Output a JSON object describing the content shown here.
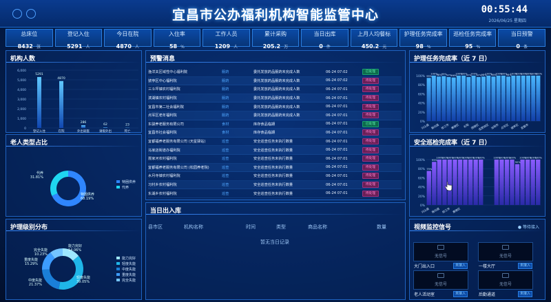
{
  "header": {
    "title": "宜昌市公办福利机构智能监管中心",
    "time": "00:55:44",
    "date": "2026/06/25 星期四"
  },
  "stats": [
    {
      "label": "总床位",
      "value": "8432",
      "unit": "张"
    },
    {
      "label": "登记入住",
      "value": "5291",
      "unit": "人"
    },
    {
      "label": "今日在院",
      "value": "4870",
      "unit": "人"
    },
    {
      "label": "入住率",
      "value": "58",
      "unit": "%"
    },
    {
      "label": "工作人员",
      "value": "1209",
      "unit": "人"
    },
    {
      "label": "累计采购",
      "value": "205.2",
      "unit": "万"
    },
    {
      "label": "当日出库",
      "value": "0",
      "unit": "件"
    },
    {
      "label": "上月人均餐标",
      "value": "450.2",
      "unit": "元"
    },
    {
      "label": "护理任务完成率",
      "value": "98",
      "unit": "%"
    },
    {
      "label": "巡检任务完成率",
      "value": "95",
      "unit": "%"
    },
    {
      "label": "当日预警",
      "value": "0",
      "unit": "条"
    }
  ],
  "panels": {
    "institution": "机构人数",
    "elder_type": "老人类型占比",
    "care_level": "护理级别分布",
    "warning": "预警消息",
    "outbound": "当日出入库",
    "care_rate": "护理任务完成率（近 7 日）",
    "patrol_rate": "安全巡检完成率（近 7 日）",
    "video": "视频监控信号",
    "video_status": "● 等待接入"
  },
  "chart_data": [
    {
      "type": "bar",
      "title": "机构人数",
      "categories": [
        "登记入住",
        "在院",
        "外出就医",
        "请假外出",
        "死亡"
      ],
      "values": [
        5291,
        4870,
        286,
        62,
        23
      ],
      "ylim": [
        0,
        6000
      ],
      "yticks": [
        0,
        1000,
        2000,
        3000,
        4000,
        5000,
        6000
      ]
    },
    {
      "type": "pie",
      "title": "老人类型占比",
      "slices": [
        {
          "name": "特困供养",
          "value": 68.19
        },
        {
          "name": "代养",
          "value": 31.81
        }
      ],
      "labels": [
        "代养\n31.81%",
        "特困供养\n68.19%"
      ],
      "colors": [
        "#2f86ff",
        "#1fd6f0"
      ]
    },
    {
      "type": "pie",
      "title": "护理级别分布",
      "slices": [
        {
          "name": "能力完好",
          "value": 14.06
        },
        {
          "name": "轻度失能",
          "value": 39.05
        },
        {
          "name": "中度失能",
          "value": 21.37
        },
        {
          "name": "重度失能",
          "value": 15.29
        },
        {
          "name": "完全失能",
          "value": 10.23
        }
      ],
      "colors": [
        "#9ee7ff",
        "#1fb6e8",
        "#1a7fd8",
        "#3d9cff",
        "#74c4ff"
      ]
    },
    {
      "type": "bar",
      "title": "护理任务完成率（近 7 日）",
      "ylim": [
        0,
        100
      ],
      "yticks": [
        "0%",
        "20%",
        "40%",
        "60%",
        "80%",
        "100%"
      ],
      "categories": [
        "兴山县",
        "",
        "秭归县",
        "",
        "枝江市",
        "",
        "夷陵区",
        "",
        "长阳",
        "",
        "西陵区",
        "",
        "伍家岗区",
        "",
        "当阳市",
        "",
        "点军区",
        "",
        "猇亭区",
        "",
        "宜都市",
        "",
        ""
      ],
      "values": [
        95,
        100,
        98,
        99,
        97,
        96,
        100,
        100,
        97,
        100,
        97,
        98,
        100,
        98,
        100,
        100,
        98,
        100,
        100,
        100,
        100,
        100,
        100
      ]
    },
    {
      "type": "bar",
      "title": "安全巡检完成率（近 7 日）",
      "ylim": [
        0,
        100
      ],
      "yticks": [
        "0%",
        "20%",
        "40%",
        "60%",
        "80%",
        "100%"
      ],
      "categories": [
        "兴山县",
        "",
        "秭归县",
        "",
        "枝江市",
        "",
        "夷陵区",
        "",
        "",
        "",
        "",
        "",
        "",
        "",
        "",
        "",
        "",
        "",
        "",
        "",
        "",
        ""
      ],
      "values": [
        75,
        95,
        100,
        100,
        100,
        100,
        100,
        100,
        100,
        100,
        100,
        0,
        0,
        100,
        100,
        100,
        100,
        90,
        100,
        100,
        100,
        100
      ]
    }
  ],
  "warnings": [
    {
      "org": "渔洋关区域性中心福利院",
      "type": "服药",
      "desc": "委托发放药品服药未完成人数",
      "time": "06-24 07:02",
      "status": "已处理"
    },
    {
      "org": "猇亭区中心福利院",
      "type": "服药",
      "desc": "委托发放药品服药未完成人数",
      "time": "06-24 07:02",
      "status": "待处理"
    },
    {
      "org": "三斗坪镇农村福利院",
      "type": "服药",
      "desc": "委托发放药品服药未完成人数",
      "time": "06-24 07:01",
      "status": "待处理"
    },
    {
      "org": "滨湖镇农村福利院",
      "type": "服药",
      "desc": "委托发放药品服药未完成人数",
      "time": "06-24 07:01",
      "status": "待处理"
    },
    {
      "org": "宜昌市第二社会福利院",
      "type": "服药",
      "desc": "委托发放药品服药未完成人数",
      "time": "06-24 07:01",
      "status": "待处理"
    },
    {
      "org": "点军区老年福利院",
      "type": "服药",
      "desc": "委托发放药品服药未完成人数",
      "time": "06-24 07:01",
      "status": "待处理"
    },
    {
      "org": "东骏养老服务有限公司",
      "type": "食材",
      "desc": "库存食品临期",
      "time": "06-24 07:01",
      "status": "已处理"
    },
    {
      "org": "宜昌市社会福利院",
      "type": "食材",
      "desc": "库存食品临期",
      "time": "06-24 07:01",
      "status": "待处理"
    },
    {
      "org": "宜都福养老服务有限公司 (天星驿站)",
      "type": "巡查",
      "desc": "安全巡查任务未执行数量",
      "time": "06-24 07:01",
      "status": "待处理"
    },
    {
      "org": "马家店街道办福利院",
      "type": "巡查",
      "desc": "安全巡查任务未执行数量",
      "time": "06-24 07:01",
      "status": "待处理"
    },
    {
      "org": "聂家河农村福利院",
      "type": "巡查",
      "desc": "安全巡查任务未执行数量",
      "time": "06-24 07:01",
      "status": "待处理"
    },
    {
      "org": "宜都福养老服务有限公司 (松园养老院)",
      "type": "巡查",
      "desc": "安全巡查任务未执行数量",
      "time": "06-24 07:01",
      "status": "待处理"
    },
    {
      "org": "水月寺镇农村福利院",
      "type": "巡查",
      "desc": "安全巡查任务未执行数量",
      "time": "06-24 07:01",
      "status": "待处理"
    },
    {
      "org": "习村乡农村福利院",
      "type": "巡查",
      "desc": "安全巡查任务未执行数量",
      "time": "06-24 07:01",
      "status": "待处理"
    },
    {
      "org": "东湖乡农村福利院",
      "type": "巡查",
      "desc": "安全巡查任务未执行数量",
      "time": "06-24 07:01",
      "status": "待处理"
    }
  ],
  "outbound_table": {
    "headers": [
      "县市区",
      "机构名称",
      "时间",
      "类型",
      "商品名称",
      "数量"
    ],
    "empty": "暂无当日记录"
  },
  "videos": [
    {
      "label": "大门出入口",
      "status": "无信号",
      "btn": "未接入"
    },
    {
      "label": "一楼大厅",
      "status": "无信号",
      "btn": "未接入"
    },
    {
      "label": "老人活动室",
      "status": "无信号",
      "btn": "未接入"
    },
    {
      "label": "后勤通道",
      "status": "无信号",
      "btn": "未接入"
    }
  ]
}
